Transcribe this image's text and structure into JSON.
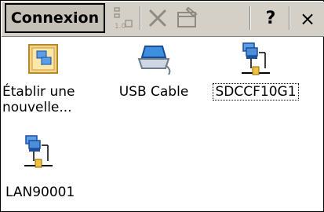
{
  "toolbar": {
    "title": "Connexion",
    "help_label": "?",
    "close_label": "×"
  },
  "items": [
    {
      "label": "Établir une nouvelle...",
      "icon": "make-new-connection-icon"
    },
    {
      "label": "USB Cable",
      "icon": "usb-cable-icon"
    },
    {
      "label": "SDCCF10G1",
      "icon": "network-connection-icon",
      "selected": true
    },
    {
      "label": "LAN90001",
      "icon": "network-connection-icon"
    }
  ]
}
